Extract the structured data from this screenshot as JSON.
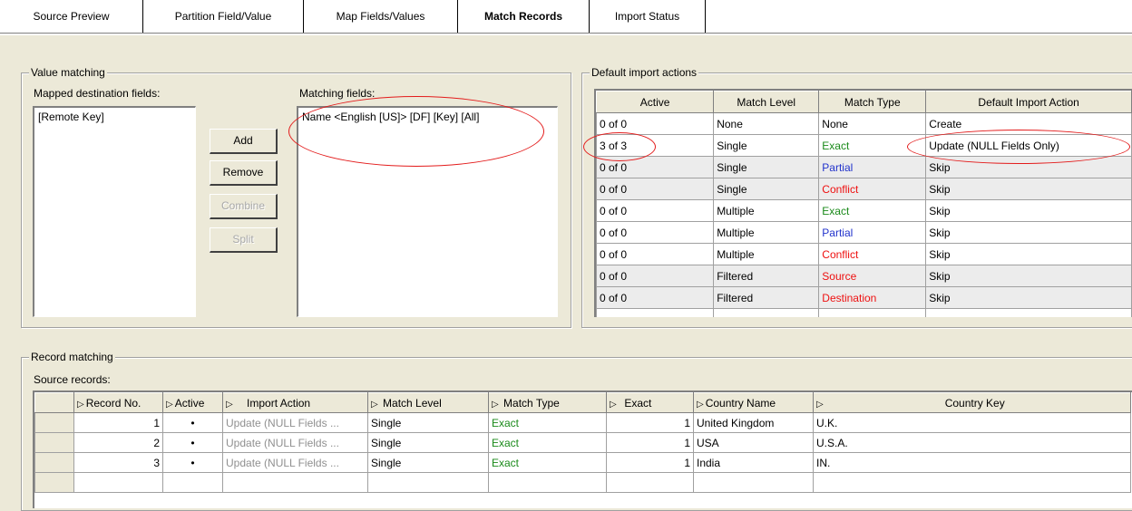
{
  "tabs": [
    {
      "label": "Source Preview",
      "active": false
    },
    {
      "label": "Partition Field/Value",
      "active": false
    },
    {
      "label": "Map Fields/Values",
      "active": false
    },
    {
      "label": "Match Records",
      "active": true
    },
    {
      "label": "Import Status",
      "active": false
    }
  ],
  "value_matching": {
    "title": "Value matching",
    "mapped_label": "Mapped destination fields:",
    "mapped_items": [
      "[Remote Key]"
    ],
    "matching_label": "Matching fields:",
    "matching_items": [
      "Name <English [US]> [DF] [Key] [All]"
    ],
    "buttons": {
      "add": "Add",
      "remove": "Remove",
      "combine": "Combine",
      "split": "Split"
    }
  },
  "default_actions": {
    "title": "Default import actions",
    "columns": [
      "Active",
      "Match Level",
      "Match Type",
      "Default Import Action"
    ],
    "rows": [
      {
        "active": "0 of 0",
        "level": "None",
        "type": "None",
        "type_color": "black",
        "action": "Create"
      },
      {
        "active": "3 of 3",
        "level": "Single",
        "type": "Exact",
        "type_color": "green",
        "action": "Update (NULL Fields Only)"
      },
      {
        "active": "0 of 0",
        "level": "Single",
        "type": "Partial",
        "type_color": "blue",
        "action": "Skip"
      },
      {
        "active": "0 of 0",
        "level": "Single",
        "type": "Conflict",
        "type_color": "red",
        "action": "Skip"
      },
      {
        "active": "0 of 0",
        "level": "Multiple",
        "type": "Exact",
        "type_color": "green",
        "action": "Skip"
      },
      {
        "active": "0 of 0",
        "level": "Multiple",
        "type": "Partial",
        "type_color": "blue",
        "action": "Skip"
      },
      {
        "active": "0 of 0",
        "level": "Multiple",
        "type": "Conflict",
        "type_color": "red",
        "action": "Skip"
      },
      {
        "active": "0 of 0",
        "level": "Filtered",
        "type": "Source",
        "type_color": "red",
        "action": "Skip"
      },
      {
        "active": "0 of 0",
        "level": "Filtered",
        "type": "Destination",
        "type_color": "red",
        "action": "Skip"
      }
    ]
  },
  "record_matching": {
    "title": "Record matching",
    "source_label": "Source records:",
    "columns": [
      "Record No.",
      "Active",
      "Import Action",
      "Match Level",
      "Match Type",
      "Exact",
      "Country Name",
      "Country Key"
    ],
    "rows": [
      {
        "no": "1",
        "active": "•",
        "action": "Update (NULL Fields ...",
        "level": "Single",
        "type": "Exact",
        "exact": "1",
        "name": "United Kingdom",
        "key": "U.K."
      },
      {
        "no": "2",
        "active": "•",
        "action": "Update (NULL Fields ...",
        "level": "Single",
        "type": "Exact",
        "exact": "1",
        "name": "USA",
        "key": "U.S.A."
      },
      {
        "no": "3",
        "active": "•",
        "action": "Update (NULL Fields ...",
        "level": "Single",
        "type": "Exact",
        "exact": "1",
        "name": "India",
        "key": "IN."
      }
    ]
  },
  "colors": {
    "green": "#1a8a1a",
    "blue": "#2233cc",
    "red": "#ee1111",
    "annotation": "#e31b1b",
    "window_bg": "#ece9d8"
  },
  "icons": {
    "sort_header": "sort-arrow-icon"
  }
}
